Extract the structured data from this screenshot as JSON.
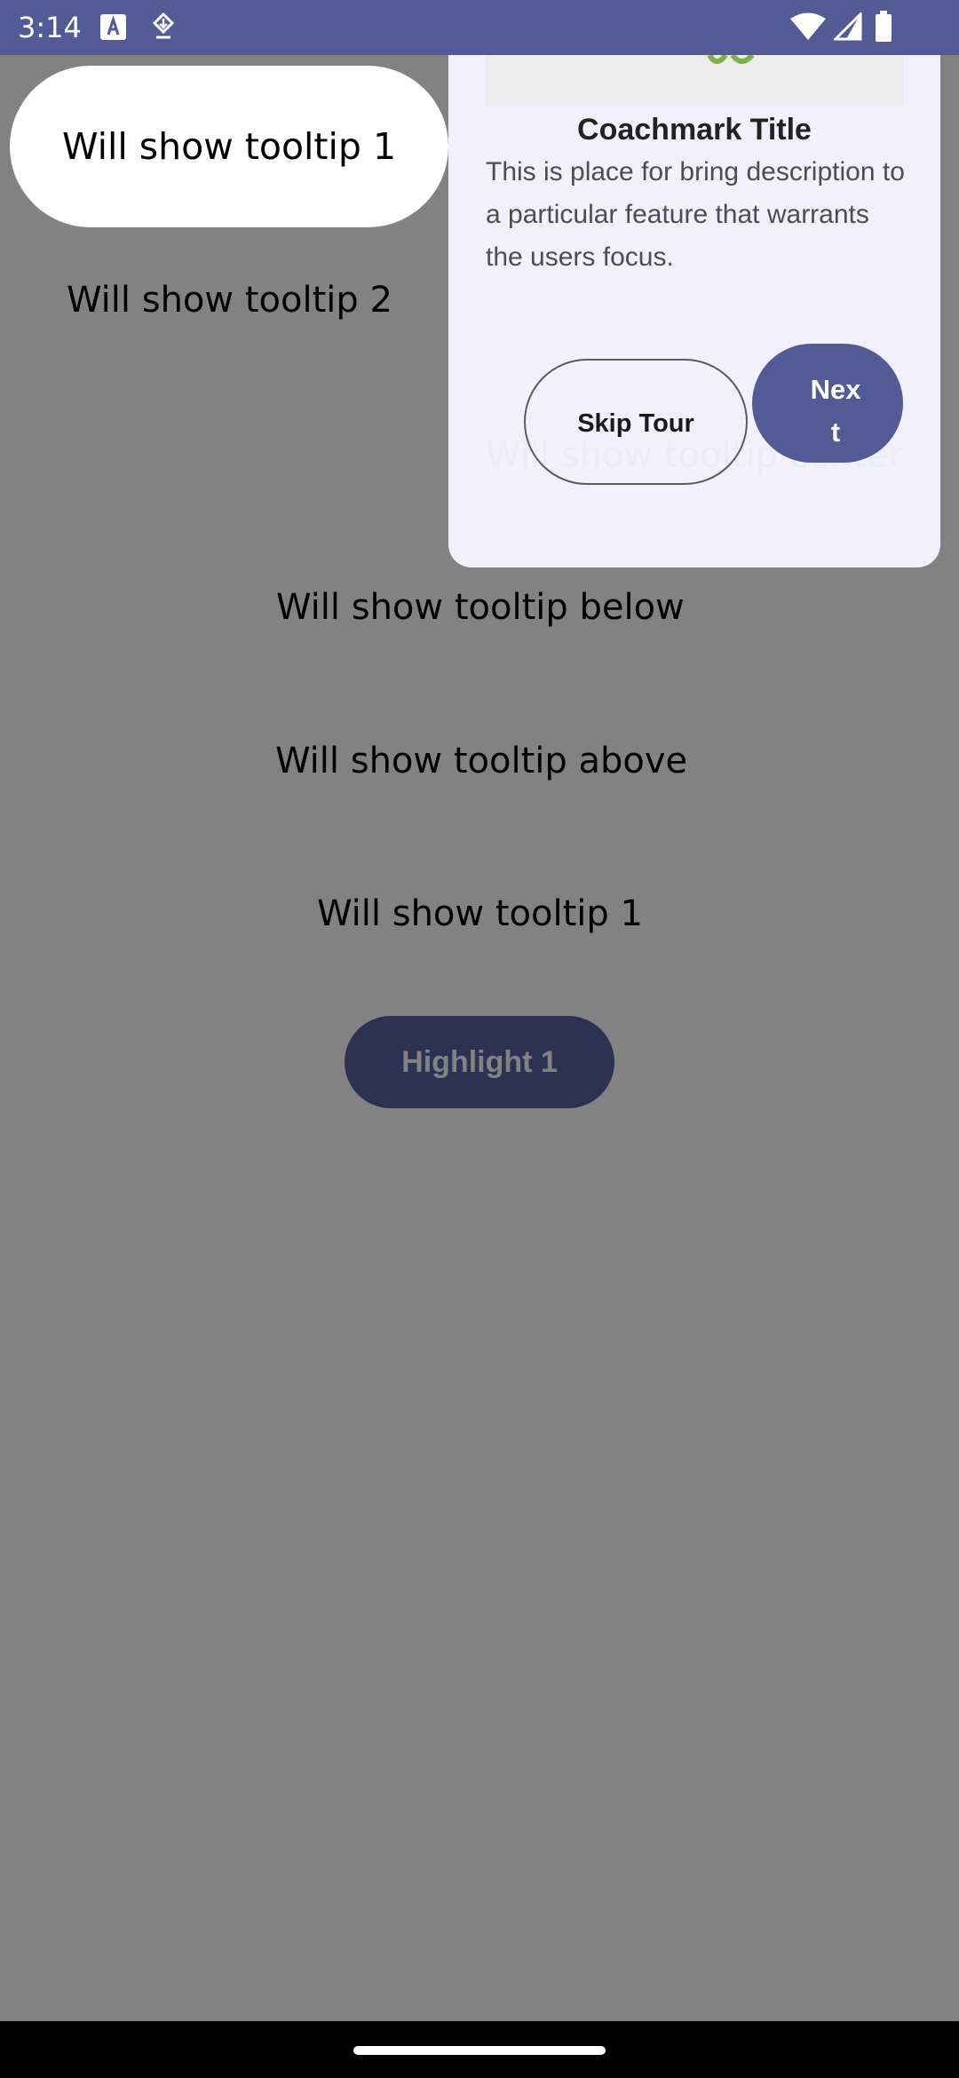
{
  "status_bar": {
    "time": "3:14",
    "icons": [
      "text-icon",
      "download-icon",
      "wifi-icon",
      "signal-icon",
      "battery-icon"
    ]
  },
  "screen": {
    "highlighted_item": "Will show tooltip 1",
    "items": [
      "Will show tooltip 2",
      "Will show tooltip below",
      "Will show tooltip above",
      "Will show tooltip 1"
    ],
    "highlight_button": "Highlight 1"
  },
  "coachmark": {
    "title": "Coachmark Title",
    "description": "This is place for bring description to a particular feature that warrants the users focus.",
    "ghost_label": "Will show tooltip center",
    "skip_label": "Skip Tour",
    "next_label": "Next"
  },
  "colors": {
    "primary": "#525b95",
    "scrim": "#828282",
    "coachmark_bg": "#f1f0fc"
  }
}
